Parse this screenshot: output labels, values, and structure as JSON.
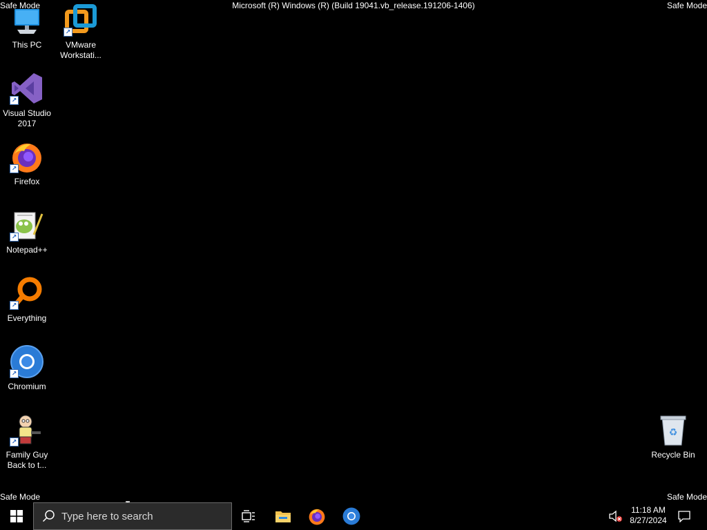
{
  "overlay": {
    "safe_mode": "Safe Mode",
    "build_string": "Microsoft (R) Windows (R) (Build 19041.vb_release.191206-1406)"
  },
  "desktop": {
    "icons": [
      {
        "label": "This PC",
        "icon": "this-pc-icon"
      },
      {
        "label": "VMware Workstati...",
        "icon": "vmware-icon"
      },
      {
        "label": "Visual Studio 2017",
        "icon": "visual-studio-icon"
      },
      {
        "label": "Firefox",
        "icon": "firefox-icon"
      },
      {
        "label": "Notepad++",
        "icon": "notepadpp-icon"
      },
      {
        "label": "Everything",
        "icon": "everything-icon"
      },
      {
        "label": "Chromium",
        "icon": "chromium-icon"
      },
      {
        "label": "Family Guy Back to t...",
        "icon": "family-guy-icon"
      },
      {
        "label": "Recycle Bin",
        "icon": "recycle-bin-icon"
      }
    ]
  },
  "taskbar": {
    "search_placeholder": "Type here to search",
    "time": "11:18 AM",
    "date": "8/27/2024",
    "pinned": [
      "task-view",
      "file-explorer",
      "firefox",
      "chromium"
    ]
  },
  "colors": {
    "desktop_bg": "#000000",
    "taskbar_bg": "#000000",
    "search_bg": "#2b2b2b"
  }
}
